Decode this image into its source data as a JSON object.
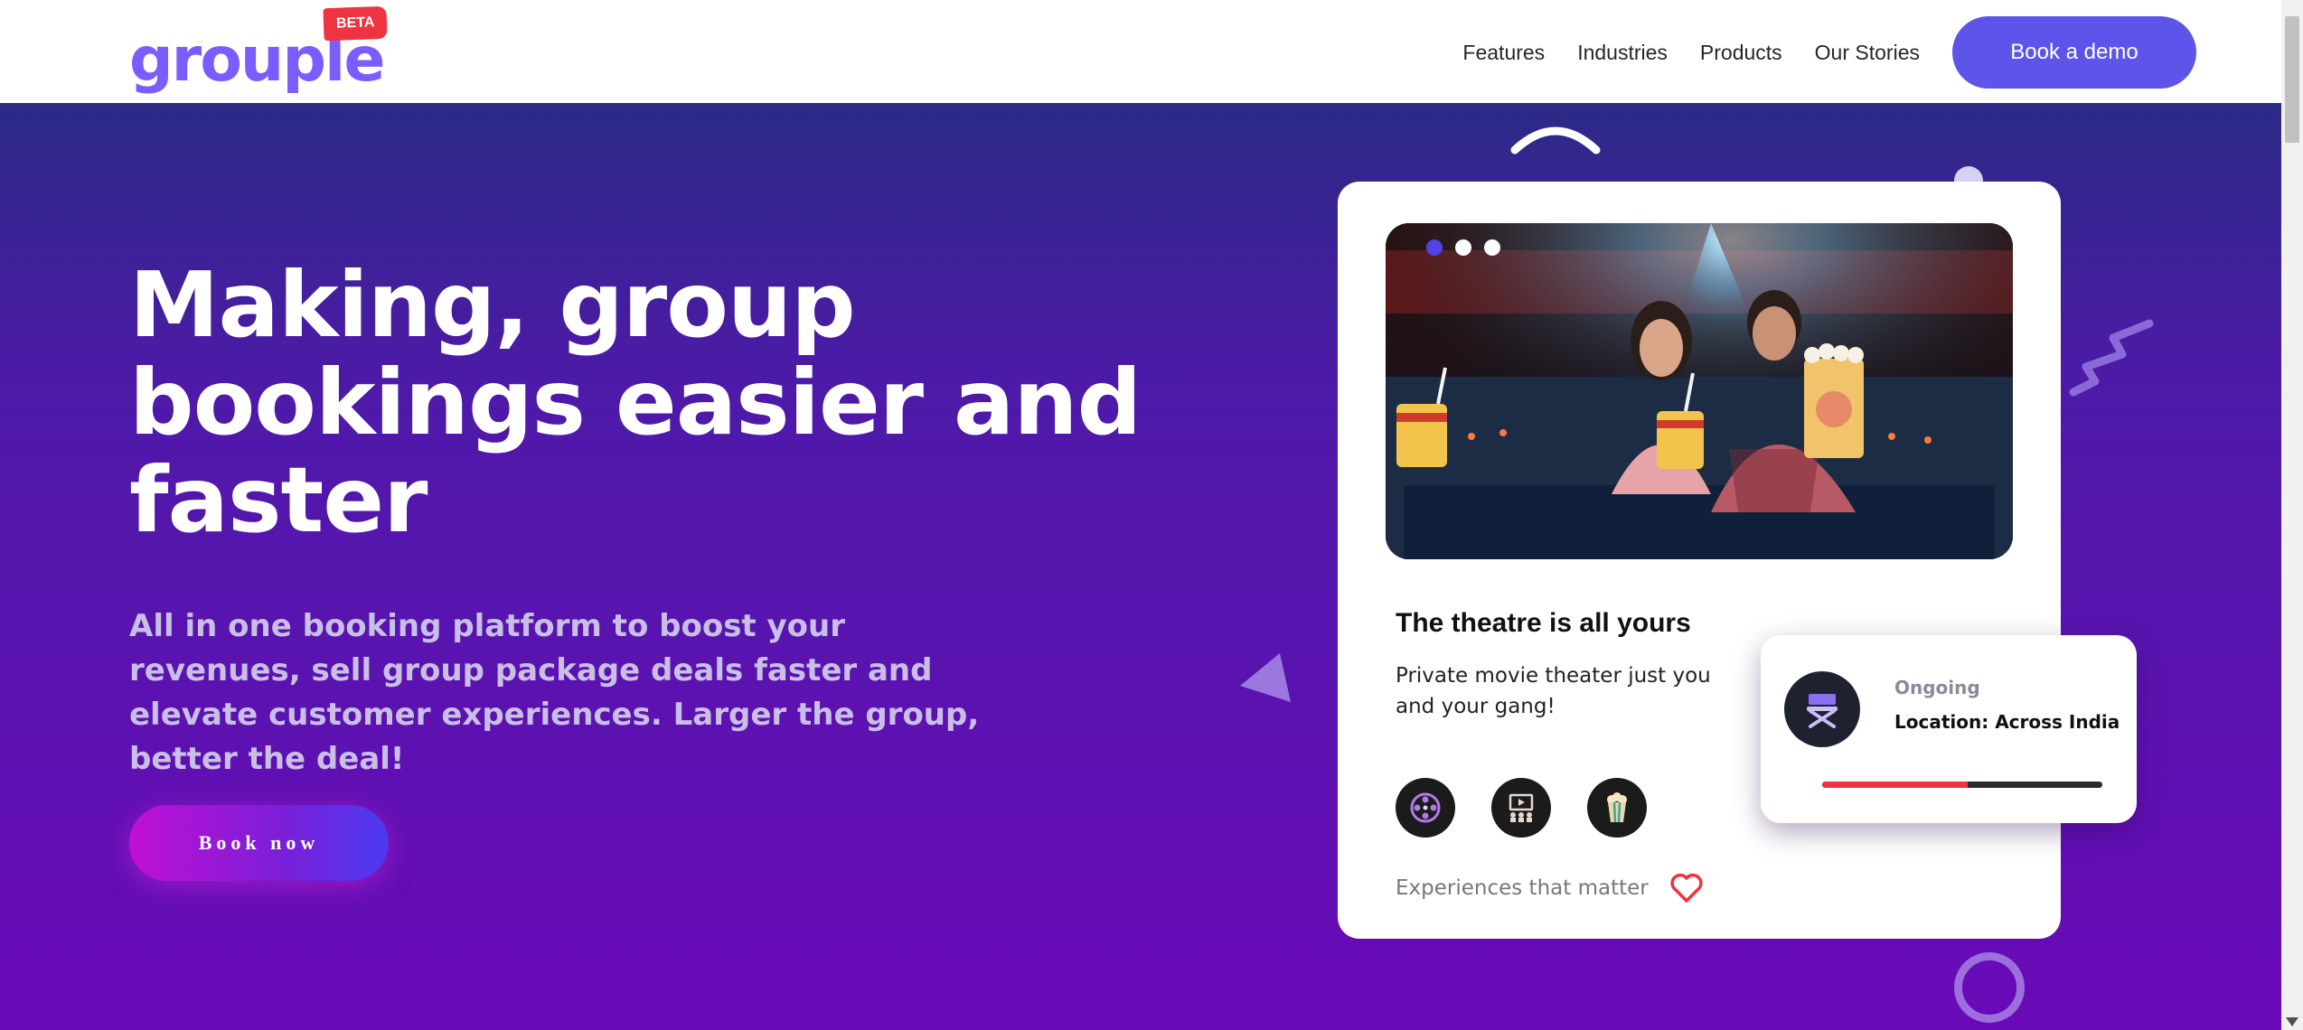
{
  "brand": {
    "logo_text": "grouple",
    "badge": "BETA"
  },
  "nav": {
    "items": [
      "Features",
      "Industries",
      "Products",
      "Our Stories"
    ],
    "cta": "Book a demo"
  },
  "hero": {
    "headline": "Making, group bookings easier and faster",
    "subtext": "All in one booking platform to boost your revenues, sell group package deals faster and elevate customer experiences. Larger the group, better the deal!",
    "cta": "Book now"
  },
  "card": {
    "carousel_dots": 3,
    "active_dot": 0,
    "title": "The theatre is all yours",
    "description": "Private movie theater just you and your gang!",
    "icons": [
      "film-reel-icon",
      "cinema-screen-icon",
      "popcorn-icon"
    ],
    "footer_text": "Experiences that matter",
    "footer_icon": "heart-icon"
  },
  "status": {
    "label": "Ongoing",
    "location": "Location: Across India",
    "progress": 0.52,
    "icon": "directors-chair-icon"
  },
  "colors": {
    "brand": "#7b5cff",
    "cta": "#5d55e9",
    "badge": "#ef3340",
    "hero_top": "#2b2a85",
    "hero_bottom": "#6a0ab8",
    "progress": "#ef3340"
  }
}
